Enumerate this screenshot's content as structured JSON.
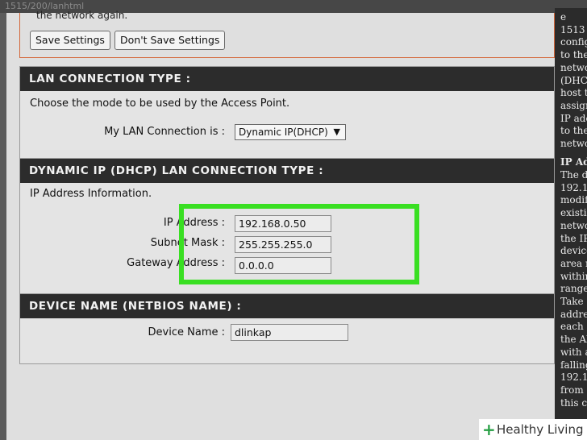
{
  "browser": {
    "url_fragment": "1515/200/lanhtml"
  },
  "top_panel": {
    "cut_text": "the network again.",
    "save_label": "Save Settings",
    "dont_save_label": "Don't Save Settings"
  },
  "lan_section": {
    "title": "LAN CONNECTION TYPE :",
    "description": "Choose the mode to be used by the Access Point.",
    "connection_label": "My LAN Connection is :",
    "connection_value": "Dynamic IP(DHCP)",
    "dropdown_glyph": "▼"
  },
  "dhcp_section": {
    "title": "DYNAMIC IP (DHCP) LAN CONNECTION TYPE :",
    "info": "IP Address Information.",
    "ip_label": "IP Address :",
    "ip_value": "192.168.0.50",
    "subnet_label": "Subnet Mask :",
    "subnet_value": "255.255.255.0",
    "gateway_label": "Gateway Address :",
    "gateway_value": "0.0.0.0"
  },
  "device_section": {
    "title": "DEVICE NAME (NETBIOS NAME) :",
    "name_label": "Device Name :",
    "name_value": "dlinkap"
  },
  "sidebar": {
    "lines_top": [
      "e",
      "1513",
      "config",
      "to the",
      "netwo",
      "(DHCP",
      "host t",
      "assign",
      "IP ado",
      "to the",
      "netwo"
    ],
    "heading": "IP Ad",
    "lines_bottom": [
      "The d",
      "192.1",
      "modif",
      "existi",
      "netwo",
      "the IP",
      "device",
      "area r",
      "within",
      "range",
      "Take",
      "addre",
      "each",
      "the Al",
      "with a",
      "falling",
      "192.1",
      "from 1",
      "this ca"
    ]
  },
  "watermark": {
    "icon": "+",
    "text": "Healthy Living"
  },
  "colors": {
    "highlight": "#39df22",
    "section_header": "#2c2c2c",
    "panel_border": "#d4673a"
  }
}
